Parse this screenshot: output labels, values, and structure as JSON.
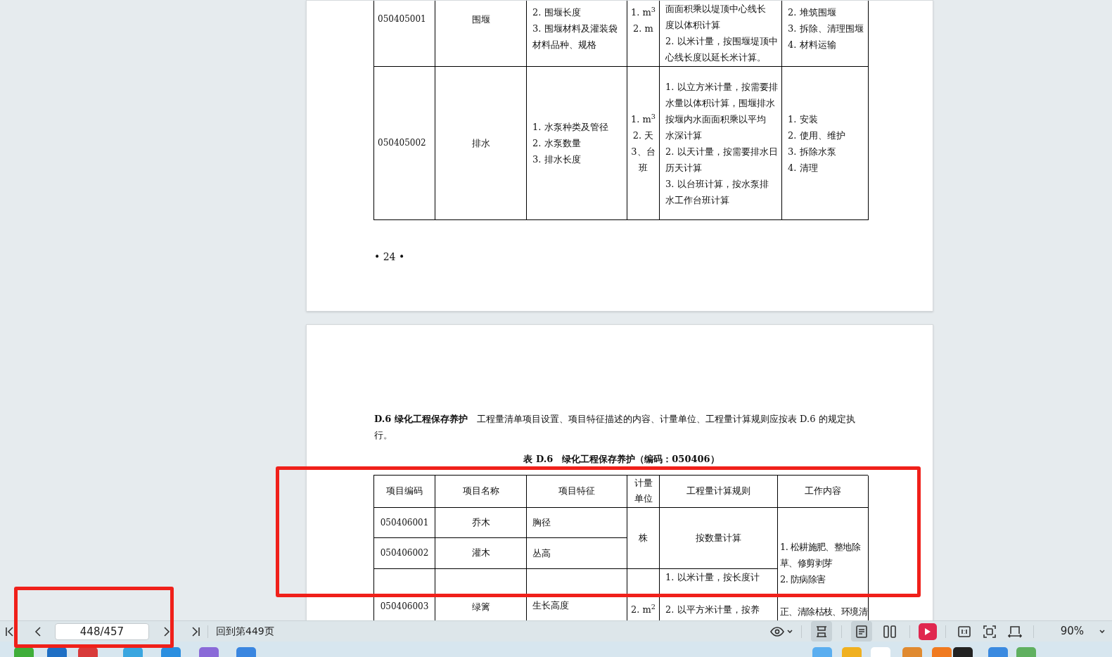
{
  "page_1": {
    "table_rows": [
      {
        "code": "050405001",
        "name": "围堰",
        "features": [
          "2. 围堰长度",
          "3. 围堰材料及灌装袋",
          "材料品种、规格"
        ],
        "units": [
          "1. m$^{3}$",
          "2. m"
        ],
        "rules": [
          "面面积乘以堤顶中心线长",
          "度以体积计算",
          "2. 以米计量，按围堰堤顶中",
          "心线长度以延长米计算。"
        ],
        "work": [
          "2. 堆筑围堰",
          "3. 拆除、清理围堰",
          "4. 材料运输"
        ]
      },
      {
        "code": "050405002",
        "name": "排水",
        "features": [
          "1. 水泵种类及管径",
          "2. 水泵数量",
          "3. 排水长度"
        ],
        "units": [
          "1. m$^{3}$",
          "2. 天",
          "3、台",
          "班"
        ],
        "rules": [
          "1. 以立方米计量，按需要排",
          "水量以体积计算，围堰排水",
          "按堰内水面面积乘以平均",
          "水深计算",
          "2. 以天计量，按需要排水日",
          "历天计算",
          "3.  以台班计算，按水泵排",
          "水工作台班计算"
        ],
        "work": [
          "1. 安装",
          "2. 使用、维护",
          "3. 拆除水泵",
          "4. 清理"
        ]
      }
    ],
    "page_number": "• 24 •"
  },
  "page_2": {
    "intro": "**D.6 绿化工程保存养护**　工程量清单项目设置、项目特征描述的内容、计量单位、工程量计算规则应按表 D.6 的规定执行。",
    "table_title": "表 D.6　绿化工程保存养护（编码：050406）",
    "columns": [
      "项目编码",
      "项目名称",
      "项目特征",
      "计量单位",
      "工程量计算规则",
      "工作内容"
    ],
    "groups": [
      {
        "rows": [
          {
            "code": "050406001",
            "name": "乔木",
            "features": [
              "胸径"
            ]
          },
          {
            "code": "050406002",
            "name": "灌木",
            "features": [
              "丛高"
            ]
          }
        ],
        "units": [
          "株"
        ],
        "rules": [
          "按数量计算"
        ]
      },
      {
        "rows": [
          {
            "code": "050406003",
            "name": "绿篱",
            "features": [
              "生长高度"
            ]
          }
        ],
        "rules": [
          "1. 以米计量，按长度计"
        ],
        "units_lower": [
          "2. m$^{2}$"
        ],
        "rules_lower": [
          "2. 以平方米计量，按养"
        ]
      }
    ],
    "work_top": [
      "1. 松耕施肥、整地除",
      "草、修剪剥芽",
      "2. 防病除害"
    ],
    "work_bottom": [
      "正、清除枯枝、环境清"
    ]
  },
  "toolbar": {
    "page_field": "448/457",
    "back_link": "回到第449页",
    "view_buttons": [
      {
        "kind": "continuous",
        "selected": true
      },
      {
        "kind": "single",
        "selected": true
      },
      {
        "kind": "double",
        "selected": false
      }
    ],
    "zoom": "90%"
  }
}
